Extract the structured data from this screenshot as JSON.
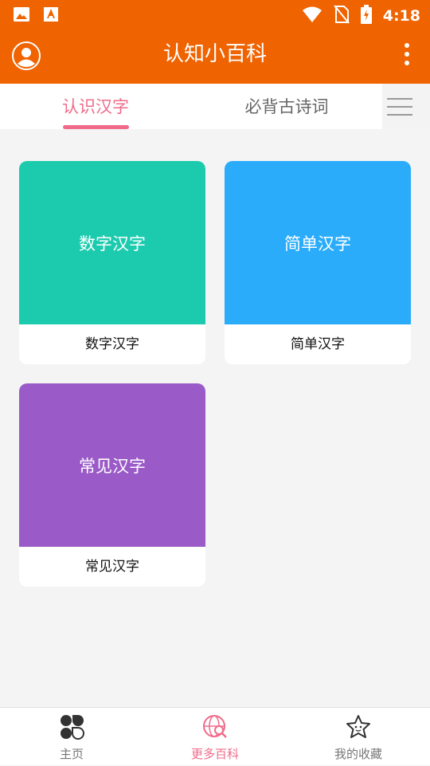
{
  "status_bar": {
    "time": "4:18"
  },
  "app_bar": {
    "title": "认知小百科"
  },
  "tabs": [
    {
      "label": "认识汉字",
      "active": true
    },
    {
      "label": "必背古诗词",
      "active": false
    }
  ],
  "cards": [
    {
      "top_label": "数字汉字",
      "bottom_label": "数字汉字",
      "color": "#1ccbae"
    },
    {
      "top_label": "简单汉字",
      "bottom_label": "简单汉字",
      "color": "#2aacfb"
    },
    {
      "top_label": "常见汉字",
      "bottom_label": "常见汉字",
      "color": "#9a5ac8"
    }
  ],
  "bottom_nav": [
    {
      "label": "主页",
      "icon": "home-grid-icon",
      "active": false
    },
    {
      "label": "更多百科",
      "icon": "globe-search-icon",
      "active": true
    },
    {
      "label": "我的收藏",
      "icon": "star-icon",
      "active": false
    }
  ],
  "colors": {
    "primary": "#ef6300",
    "accent": "#f06b8a"
  }
}
